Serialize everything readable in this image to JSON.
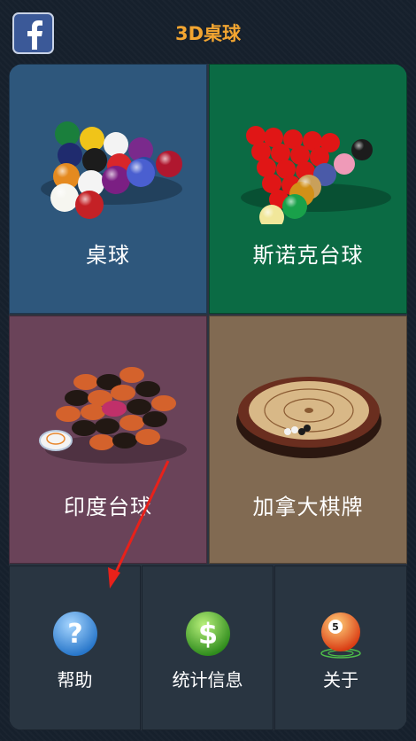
{
  "header": {
    "title": "3D桌球",
    "facebook_icon": "facebook-icon"
  },
  "tiles": [
    {
      "label": "桌球",
      "icon": "pool-balls-rack-icon"
    },
    {
      "label": "斯诺克台球",
      "icon": "snooker-balls-rack-icon"
    },
    {
      "label": "印度台球",
      "icon": "carrom-coins-icon"
    },
    {
      "label": "加拿大棋牌",
      "icon": "crokinole-board-icon"
    }
  ],
  "bottom_buttons": [
    {
      "label": "帮助",
      "icon": "help-question-icon"
    },
    {
      "label": "统计信息",
      "icon": "dollar-stats-icon"
    },
    {
      "label": "关于",
      "icon": "ball-five-about-icon"
    }
  ],
  "colors": {
    "title": "#f2a531",
    "pool_tile": "#2e577c",
    "snooker_tile": "#0b6b44",
    "carrom_tile": "#6a4359",
    "crokinole_tile": "#816a52",
    "annotation_arrow": "#e8211a"
  }
}
